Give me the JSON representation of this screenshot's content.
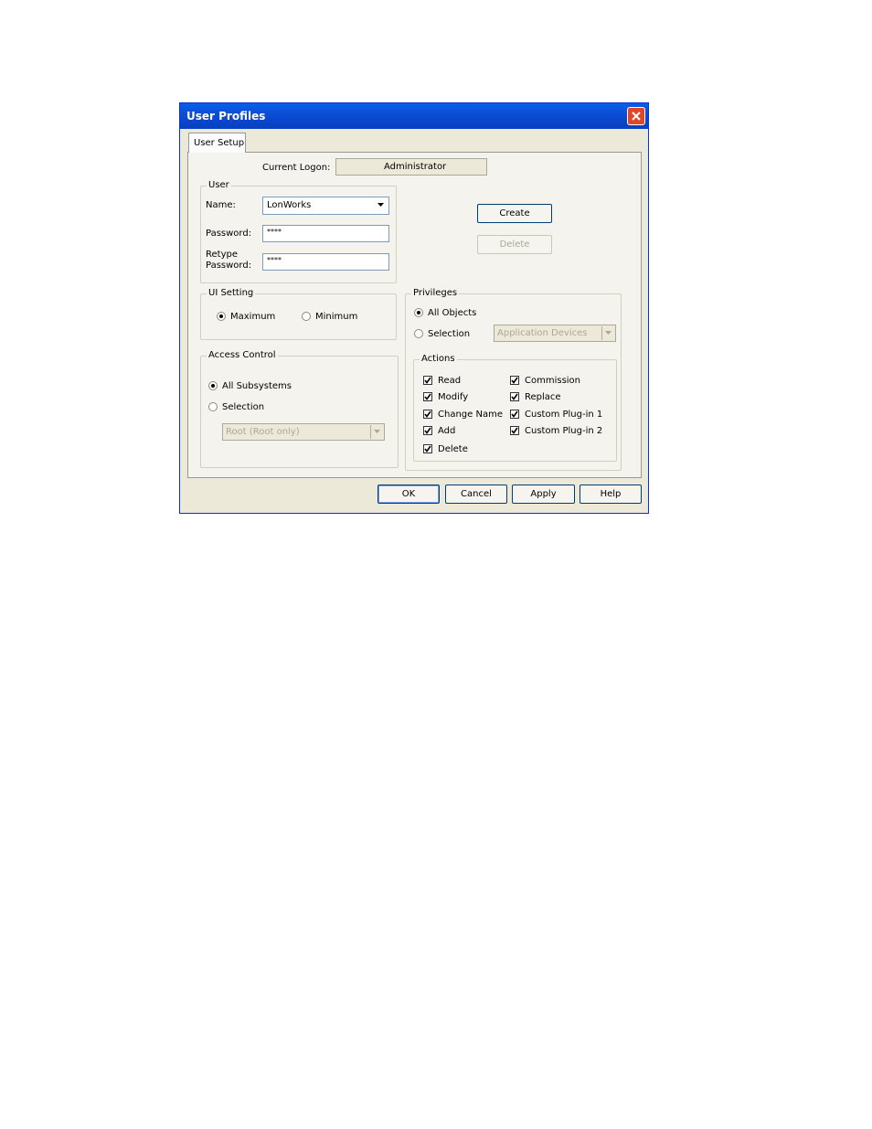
{
  "window": {
    "title": "User Profiles"
  },
  "tabs": [
    {
      "label": "User Setup"
    }
  ],
  "logon": {
    "label": "Current Logon:",
    "value": "Administrator"
  },
  "user_group": {
    "legend": "User",
    "name_label": "Name:",
    "name_value": "LonWorks",
    "password_label": "Password:",
    "password_value": "****",
    "retype_label_1": "Retype",
    "retype_label_2": "Password:",
    "retype_value": "****"
  },
  "actions_buttons": {
    "create": "Create",
    "delete": "Delete"
  },
  "ui_setting": {
    "legend": "UI Setting",
    "maximum": "Maximum",
    "minimum": "Minimum",
    "selected": "Maximum"
  },
  "access_control": {
    "legend": "Access Control",
    "all_subsystems": "All Subsystems",
    "selection": "Selection",
    "selected": "All Subsystems",
    "combo_value": "Root (Root only)"
  },
  "privileges": {
    "legend": "Privileges",
    "all_objects": "All Objects",
    "selection": "Selection",
    "selected": "All Objects",
    "combo_value": "Application Devices",
    "actions_legend": "Actions",
    "actions": [
      {
        "label": "Read",
        "checked": true
      },
      {
        "label": "Modify",
        "checked": true
      },
      {
        "label": "Change Name",
        "checked": true
      },
      {
        "label": "Add",
        "checked": true
      },
      {
        "label": "Delete",
        "checked": true
      },
      {
        "label": "Commission",
        "checked": true
      },
      {
        "label": "Replace",
        "checked": true
      },
      {
        "label": "Custom Plug-in 1",
        "checked": true
      },
      {
        "label": "Custom Plug-in 2",
        "checked": true
      }
    ]
  },
  "footer": {
    "ok": "OK",
    "cancel": "Cancel",
    "apply": "Apply",
    "help": "Help"
  },
  "colors": {
    "titlebar": "#0a5ee6",
    "dialog": "#ece9d8",
    "close": "#e1462a"
  },
  "icons": {
    "close": "close-icon",
    "dropdown": "chevron-down-icon",
    "check": "checkmark-icon"
  }
}
